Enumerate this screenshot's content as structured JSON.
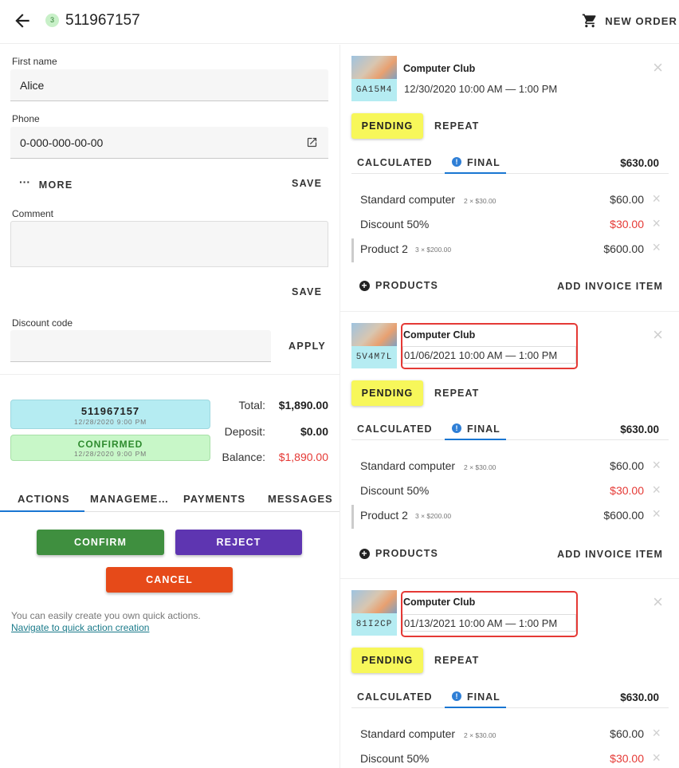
{
  "header": {
    "order_badge": "3",
    "order_id": "511967157",
    "new_order_label": "NEW ORDER"
  },
  "form": {
    "first_name_label": "First name",
    "first_name_value": "Alice",
    "phone_label": "Phone",
    "phone_value": "0-000-000-00-00",
    "more_label": "MORE",
    "save_label": "SAVE",
    "comment_label": "Comment",
    "comment_value": "",
    "comment_save_label": "SAVE",
    "discount_label": "Discount code",
    "discount_value": "",
    "apply_label": "APPLY"
  },
  "status": {
    "order_chip": {
      "main": "511967157",
      "sub": "12/28/2020 9:00 PM"
    },
    "confirmed_chip": {
      "main": "CONFIRMED",
      "sub": "12/28/2020 9:00 PM"
    },
    "total_label": "Total:",
    "total_value": "$1,890.00",
    "deposit_label": "Deposit:",
    "deposit_value": "$0.00",
    "balance_label": "Balance:",
    "balance_value": "$1,890.00"
  },
  "tabs": [
    "ACTIONS",
    "MANAGEME…",
    "PAYMENTS",
    "MESSAGES"
  ],
  "actions": {
    "confirm": "CONFIRM",
    "reject": "REJECT",
    "cancel": "CANCEL",
    "hint": "You can easily create you own quick actions.",
    "link": "Navigate to quick action creation"
  },
  "colors": {
    "confirm": "#3f8f3f",
    "reject": "#5e35b1",
    "cancel": "#e64a19",
    "order_chip_bg": "#b5ecf2",
    "confirmed_chip_bg": "#c8f7c8",
    "confirmed_text": "#2e8b2e",
    "pending_bg": "#f7f75a",
    "negative": "#e53935",
    "highlight_box": "#e53935"
  },
  "cards": [
    {
      "venue": "Computer Club",
      "code": "GA15M4",
      "datetime": "12/30/2020 10:00 AM — 1:00 PM",
      "status": "PENDING",
      "repeat": "REPEAT",
      "tab_calculated": "CALCULATED",
      "tab_final": "FINAL",
      "total": "$630.00",
      "items": [
        {
          "name": "Standard computer",
          "qty": "2 × $30.00",
          "amount": "$60.00",
          "negative": false
        },
        {
          "name": "Discount 50%",
          "qty": "",
          "amount": "$30.00",
          "negative": true
        },
        {
          "name": "Product 2",
          "qty": "3 × $200.00",
          "amount": "$600.00",
          "negative": false
        }
      ],
      "products_label": "PRODUCTS",
      "add_invoice_label": "ADD INVOICE ITEM",
      "highlighted": false
    },
    {
      "venue": "Computer Club",
      "code": "5V4M7L",
      "datetime": "01/06/2021 10:00 AM — 1:00 PM",
      "status": "PENDING",
      "repeat": "REPEAT",
      "tab_calculated": "CALCULATED",
      "tab_final": "FINAL",
      "total": "$630.00",
      "items": [
        {
          "name": "Standard computer",
          "qty": "2 × $30.00",
          "amount": "$60.00",
          "negative": false
        },
        {
          "name": "Discount 50%",
          "qty": "",
          "amount": "$30.00",
          "negative": true
        },
        {
          "name": "Product 2",
          "qty": "3 × $200.00",
          "amount": "$600.00",
          "negative": false
        }
      ],
      "products_label": "PRODUCTS",
      "add_invoice_label": "ADD INVOICE ITEM",
      "highlighted": true
    },
    {
      "venue": "Computer Club",
      "code": "81I2CP",
      "datetime": "01/13/2021 10:00 AM — 1:00 PM",
      "status": "PENDING",
      "repeat": "REPEAT",
      "tab_calculated": "CALCULATED",
      "tab_final": "FINAL",
      "total": "$630.00",
      "items": [
        {
          "name": "Standard computer",
          "qty": "2 × $30.00",
          "amount": "$60.00",
          "negative": false
        },
        {
          "name": "Discount 50%",
          "qty": "",
          "amount": "$30.00",
          "negative": true
        }
      ],
      "highlighted": true
    }
  ]
}
